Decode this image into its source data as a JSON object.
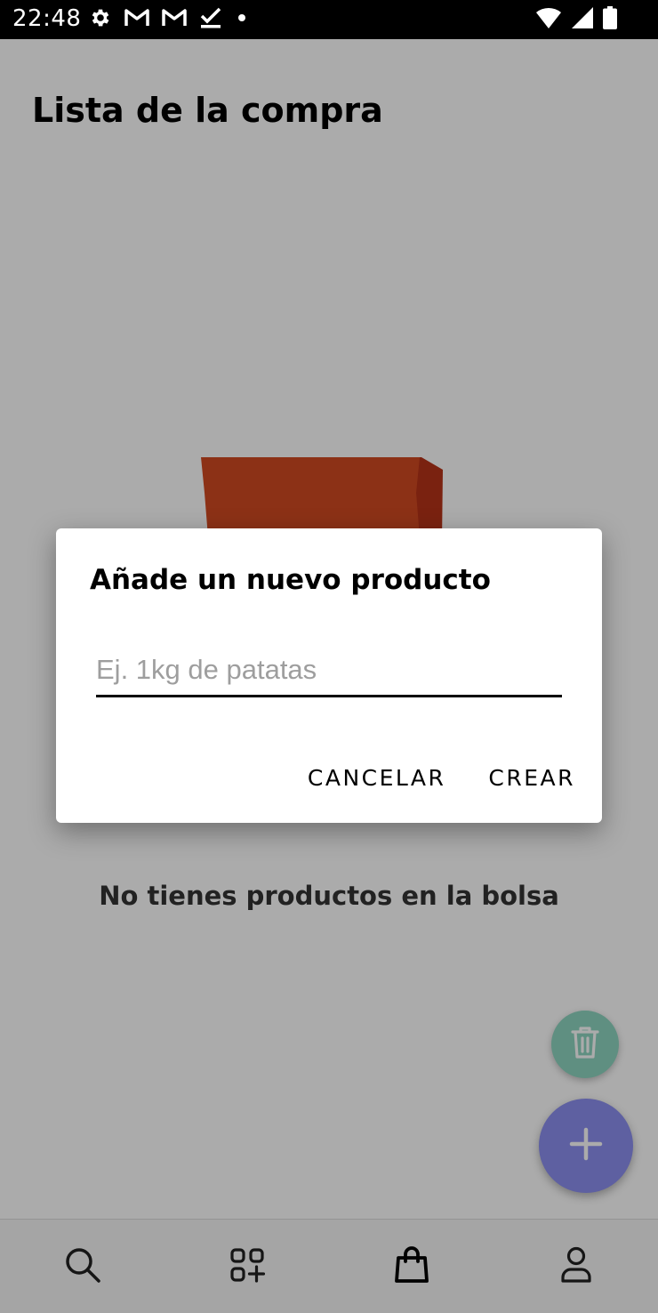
{
  "status_bar": {
    "time": "22:48",
    "left_icons": [
      "settings-icon",
      "gmail-icon",
      "gmail-icon",
      "task-done-icon",
      "notification-dot-icon"
    ],
    "right_icons": [
      "wifi-icon",
      "signal-icon",
      "battery-icon"
    ]
  },
  "header": {
    "title": "Lista de la compra"
  },
  "empty_state": {
    "message": "No tienes productos en la bolsa",
    "illustration": "shopping-bag-illustration"
  },
  "fabs": {
    "trash": {
      "icon": "trash-icon",
      "color": "#8ed6c0"
    },
    "add": {
      "icon": "plus-icon",
      "color": "#8c8ff0"
    }
  },
  "bottom_nav": {
    "items": [
      {
        "icon": "search-icon",
        "active": false
      },
      {
        "icon": "categories-add-icon",
        "active": false
      },
      {
        "icon": "shopping-bag-icon",
        "active": true
      },
      {
        "icon": "profile-icon",
        "active": false
      }
    ]
  },
  "dialog": {
    "title": "Añade un nuevo producto",
    "input": {
      "placeholder": "Ej. 1kg de patatas",
      "value": ""
    },
    "cancel_label": "CANCELAR",
    "create_label": "CREAR"
  },
  "colors": {
    "bag_orange": "#d14a22",
    "bag_shade": "#b63319",
    "scrim": "rgba(0,0,0,0.33)"
  }
}
